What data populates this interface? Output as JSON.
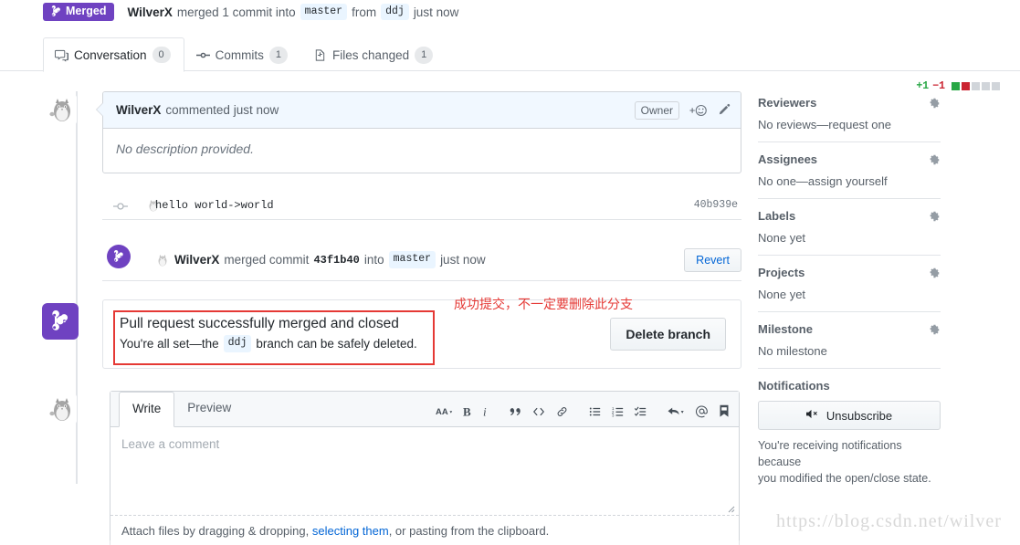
{
  "header": {
    "state_label": "Merged",
    "state_color": "#6f42c1",
    "author": "WilverX",
    "action_text": "merged 1 commit into",
    "base_branch": "master",
    "from_text": "from",
    "head_branch": "ddj",
    "time": "just now"
  },
  "tabs": [
    {
      "label": "Conversation",
      "count": "0",
      "icon": "comment-discussion-icon",
      "active": true
    },
    {
      "label": "Commits",
      "count": "1",
      "icon": "git-commit-icon",
      "active": false
    },
    {
      "label": "Files changed",
      "count": "1",
      "icon": "diff-file-icon",
      "active": false
    }
  ],
  "diffstat": {
    "additions": "+1",
    "deletions": "−1",
    "add_color": "#28a745",
    "del_color": "#cb2431",
    "blocks": [
      "g",
      "r",
      "n",
      "n",
      "n"
    ]
  },
  "comment": {
    "author": "WilverX",
    "meta": "commented just now",
    "role_badge": "Owner",
    "body": "No description provided."
  },
  "commit_row": {
    "message": "hello world->world",
    "sha": "40b939e"
  },
  "merged_row": {
    "author": "WilverX",
    "text_before": "merged commit",
    "sha": "43f1b40",
    "text_mid": "into",
    "branch": "master",
    "time": "just now",
    "revert_label": "Revert"
  },
  "merge_box": {
    "title": "Pull request successfully merged and closed",
    "subtitle_before": "You're all set—the",
    "branch": "ddj",
    "subtitle_after": "branch can be safely deleted.",
    "delete_label": "Delete branch",
    "annotation": "成功提交，不一定要删除此分支",
    "annotation_color": "#e53935"
  },
  "editor": {
    "tabs": [
      {
        "label": "Write",
        "active": true
      },
      {
        "label": "Preview",
        "active": false
      }
    ],
    "placeholder": "Leave a comment",
    "value": "",
    "toolbar": [
      "heading-icon",
      "bold-icon",
      "italic-icon",
      "quote-icon",
      "code-icon",
      "link-icon",
      "unordered-list-icon",
      "ordered-list-icon",
      "task-list-icon",
      "reply-icon",
      "mention-icon",
      "saved-reply-icon"
    ],
    "attach_before": "Attach files by dragging & dropping,",
    "attach_link": "selecting them",
    "attach_after": ", or pasting from the clipboard."
  },
  "sidebar": [
    {
      "title": "Reviewers",
      "body": "No reviews—request one",
      "gear": true
    },
    {
      "title": "Assignees",
      "body": "No one—assign yourself",
      "gear": true
    },
    {
      "title": "Labels",
      "body": "None yet",
      "gear": true
    },
    {
      "title": "Projects",
      "body": "None yet",
      "gear": true
    },
    {
      "title": "Milestone",
      "body": "No milestone",
      "gear": true
    }
  ],
  "notifications": {
    "title": "Notifications",
    "button_label": "Unsubscribe",
    "note_line1": "You're receiving notifications because",
    "note_line2": "you modified the open/close state."
  },
  "watermark": "https://blog.csdn.net/wilver"
}
